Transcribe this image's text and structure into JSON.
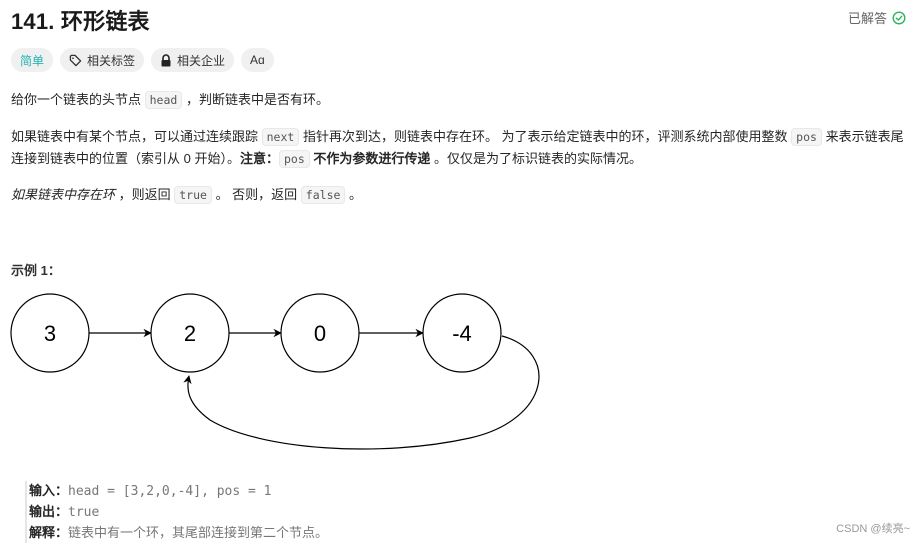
{
  "header": {
    "title": "141. 环形链表",
    "solved_label": "已解答",
    "solved_color": "#2db55d"
  },
  "tags": {
    "difficulty": "简单",
    "difficulty_color": "#22b3b3",
    "related_tags": "相关标签",
    "related_companies": "相关企业",
    "font_toggle": "Aɑ"
  },
  "description": {
    "p1": {
      "before": "给你一个链表的头节点 ",
      "code": "head",
      "after": " ，判断链表中是否有环。"
    },
    "p2": {
      "s1": "如果链表中有某个节点，可以通过连续跟踪 ",
      "code1": "next",
      "s2": " 指针再次到达，则链表中存在环。 为了表示给定链表中的环，评测系统内部使用整数 ",
      "code2": "pos",
      "s3": " 来表示链表尾连接到链表中的位置（索引从 0 开始）。",
      "note_label": "注意：",
      "code3": "pos",
      "note_bold": " 不作为参数进行传递 ",
      "s4": "。仅仅是为了标识链表的实际情况。"
    },
    "p3": {
      "italic": "如果链表中存在环",
      "s1": " ，则返回 ",
      "code1": "true",
      "s2": " 。 否则，返回 ",
      "code2": "false",
      "s3": " 。"
    }
  },
  "example": {
    "title": "示例 1：",
    "diagram": {
      "nodes": [
        "3",
        "2",
        "0",
        "-4"
      ],
      "cycle_to_index": 1
    },
    "input_label": "输入：",
    "input_value": "head = [3,2,0,-4], pos = 1",
    "output_label": "输出：",
    "output_value": "true",
    "explain_label": "解释：",
    "explain_value": "链表中有一个环，其尾部连接到第二个节点。"
  },
  "watermark": "CSDN @续亮~"
}
